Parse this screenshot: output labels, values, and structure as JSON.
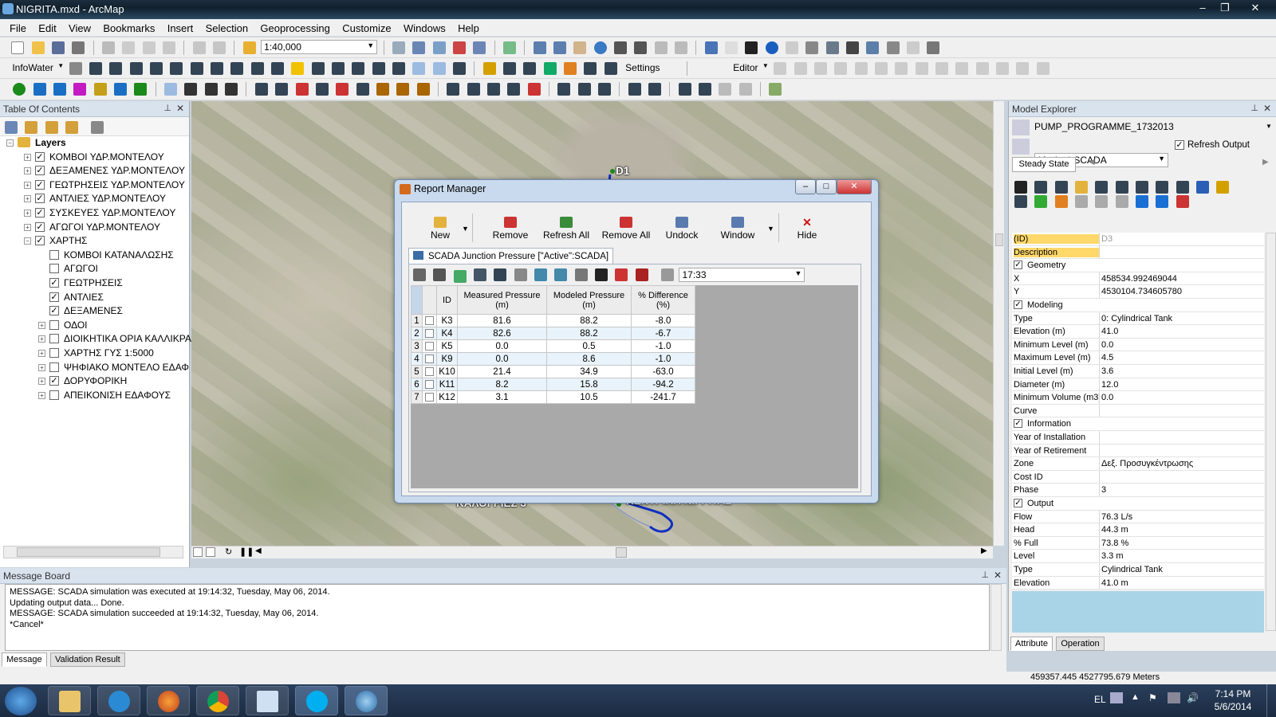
{
  "window": {
    "title": "NIGRITA.mxd - ArcMap"
  },
  "menu": [
    "File",
    "Edit",
    "View",
    "Bookmarks",
    "Insert",
    "Selection",
    "Geoprocessing",
    "Customize",
    "Windows",
    "Help"
  ],
  "toolbar": {
    "scale": "1:40,000",
    "infowater_label": "InfoWater",
    "settings_label": "Settings",
    "editor_label": "Editor"
  },
  "toc": {
    "title": "Table Of Contents",
    "layers_label": "Layers",
    "items": [
      {
        "label": "ΚΟΜΒΟΙ ΥΔΡ.ΜΟΝΤΕΛΟΥ",
        "checked": true,
        "level": 1,
        "expander": "+"
      },
      {
        "label": "ΔΕΞΑΜΕΝΕΣ ΥΔΡ.ΜΟΝΤΕΛΟΥ",
        "checked": true,
        "level": 1,
        "expander": "+"
      },
      {
        "label": "ΓΕΩΤΡΗΣΕΙΣ ΥΔΡ.ΜΟΝΤΕΛΟΥ",
        "checked": true,
        "level": 1,
        "expander": "+"
      },
      {
        "label": "ΑΝΤΛΙΕΣ ΥΔΡ.ΜΟΝΤΕΛΟΥ",
        "checked": true,
        "level": 1,
        "expander": "+"
      },
      {
        "label": "ΣΥΣΚΕΥΕΣ ΥΔΡ.ΜΟΝΤΕΛΟΥ",
        "checked": true,
        "level": 1,
        "expander": "+"
      },
      {
        "label": "ΑΓΩΓΟΙ ΥΔΡ.ΜΟΝΤΕΛΟΥ",
        "checked": true,
        "level": 1,
        "expander": "+"
      },
      {
        "label": "ΧΑΡΤΗΣ",
        "checked": true,
        "level": 1,
        "expander": "−"
      },
      {
        "label": "ΚΟΜΒΟΙ ΚΑΤΑΝΑΛΩΣΗΣ",
        "checked": false,
        "level": 2,
        "expander": ""
      },
      {
        "label": "ΑΓΩΓΟΙ",
        "checked": false,
        "level": 2,
        "expander": ""
      },
      {
        "label": "ΓΕΩΤΡΗΣΕΙΣ",
        "checked": true,
        "level": 2,
        "expander": ""
      },
      {
        "label": "ΑΝΤΛΙΕΣ",
        "checked": true,
        "level": 2,
        "expander": ""
      },
      {
        "label": "ΔΕΞΑΜΕΝΕΣ",
        "checked": true,
        "level": 2,
        "expander": ""
      },
      {
        "label": "ΟΔΟΙ",
        "checked": false,
        "level": 2,
        "expander": "+"
      },
      {
        "label": "ΔΙΟΙΚΗΤΙΚΑ ΟΡΙΑ ΚΑΛΛΙΚΡΑ",
        "checked": false,
        "level": 2,
        "expander": "+"
      },
      {
        "label": "ΧΑΡΤΗΣ ΓΥΣ 1:5000",
        "checked": false,
        "level": 2,
        "expander": "+"
      },
      {
        "label": "ΨΗΦΙΑΚΟ ΜΟΝΤΕΛΟ ΕΔΑΦ",
        "checked": false,
        "level": 2,
        "expander": "+"
      },
      {
        "label": "ΔΟΡΥΦΟΡΙΚΗ",
        "checked": true,
        "level": 2,
        "expander": "+"
      },
      {
        "label": "ΑΠΕΙΚΟΝΙΣΗ ΕΔΑΦΟΥΣ",
        "checked": false,
        "level": 2,
        "expander": "+"
      }
    ]
  },
  "map": {
    "labels": {
      "d1": "D1",
      "kalogries": "ΚΑΛΟΓΡΙΕΣ 3",
      "kentriki": "ΚΕΝΤΡΙΚΗ ΝΙΓΡΙΤΑΣ"
    }
  },
  "report_manager": {
    "title": "Report Manager",
    "buttons": {
      "new": "New",
      "remove": "Remove",
      "refresh_all": "Refresh All",
      "remove_all": "Remove All",
      "undock": "Undock",
      "window": "Window",
      "hide": "Hide"
    },
    "tab_label": "SCADA Junction Pressure [\"Active\":SCADA]",
    "time": "17:33",
    "columns": {
      "id": "ID",
      "measured": "Measured Pressure (m)",
      "modeled": "Modeled Pressure (m)",
      "diff": "% Difference (%)"
    },
    "rows": [
      {
        "n": "1",
        "id": "K3",
        "measured": "81.6",
        "modeled": "88.2",
        "diff": "-8.0"
      },
      {
        "n": "2",
        "id": "K4",
        "measured": "82.6",
        "modeled": "88.2",
        "diff": "-6.7"
      },
      {
        "n": "3",
        "id": "K5",
        "measured": "0.0",
        "modeled": "0.5",
        "diff": "-1.0"
      },
      {
        "n": "4",
        "id": "K9",
        "measured": "0.0",
        "modeled": "8.6",
        "diff": "-1.0"
      },
      {
        "n": "5",
        "id": "K10",
        "measured": "21.4",
        "modeled": "34.9",
        "diff": "-63.0"
      },
      {
        "n": "6",
        "id": "K11",
        "measured": "8.2",
        "modeled": "15.8",
        "diff": "-94.2"
      },
      {
        "n": "7",
        "id": "K12",
        "measured": "3.1",
        "modeled": "10.5",
        "diff": "-241.7"
      }
    ]
  },
  "message_board": {
    "title": "Message Board",
    "lines": [
      "MESSAGE: SCADA simulation was executed at 19:14:32, Tuesday, May 06, 2014.",
      "Updating output data... Done.",
      "MESSAGE: SCADA simulation succeeded at 19:14:32, Tuesday, May 06, 2014.",
      "*Cancel*"
    ],
    "tabs": [
      "Message",
      "Validation Result"
    ]
  },
  "model_explorer": {
    "title": "Model Explorer",
    "project": "PUMP_PROGRAMME_1732013",
    "scenario": "*Active*:SCADA",
    "refresh_output": "Refresh Output",
    "steady_state": "Steady State",
    "properties": [
      {
        "k": "(ID)",
        "v": "D3",
        "type": "sel"
      },
      {
        "k": "Description",
        "v": "",
        "type": "sel"
      },
      {
        "k": "Geometry",
        "type": "cat"
      },
      {
        "k": "X",
        "v": "458534.992469044"
      },
      {
        "k": "Y",
        "v": "4530104.734605780"
      },
      {
        "k": "Modeling",
        "type": "cat"
      },
      {
        "k": "Type",
        "v": "0: Cylindrical Tank"
      },
      {
        "k": "Elevation (m)",
        "v": "41.0"
      },
      {
        "k": "Minimum Level (m)",
        "v": "0.0"
      },
      {
        "k": "Maximum Level (m)",
        "v": "4.5"
      },
      {
        "k": "Initial Level (m)",
        "v": "3.6"
      },
      {
        "k": "Diameter (m)",
        "v": "12.0"
      },
      {
        "k": "Minimum Volume (m3)",
        "v": "0.0"
      },
      {
        "k": "Curve",
        "v": ""
      },
      {
        "k": "Information",
        "type": "cat"
      },
      {
        "k": "Year of Installation",
        "v": ""
      },
      {
        "k": "Year of Retirement",
        "v": ""
      },
      {
        "k": "Zone",
        "v": "Δεξ. Προσυγκέντρωσης"
      },
      {
        "k": "Cost ID",
        "v": ""
      },
      {
        "k": "Phase",
        "v": "3"
      },
      {
        "k": "Output",
        "type": "cat"
      },
      {
        "k": "Flow",
        "v": "76.3 L/s"
      },
      {
        "k": "Head",
        "v": "44.3 m"
      },
      {
        "k": "% Full",
        "v": "73.8 %"
      },
      {
        "k": "Level",
        "v": "3.3 m"
      },
      {
        "k": "Type",
        "v": "Cylindrical Tank"
      },
      {
        "k": "Elevation",
        "v": "41.0 m"
      }
    ],
    "tabs": [
      "Attribute",
      "Operation"
    ]
  },
  "status": {
    "coords": "459357.445  4527795.679 Meters"
  },
  "taskbar": {
    "lang": "EL",
    "time": "7:14 PM",
    "date": "5/6/2014"
  }
}
